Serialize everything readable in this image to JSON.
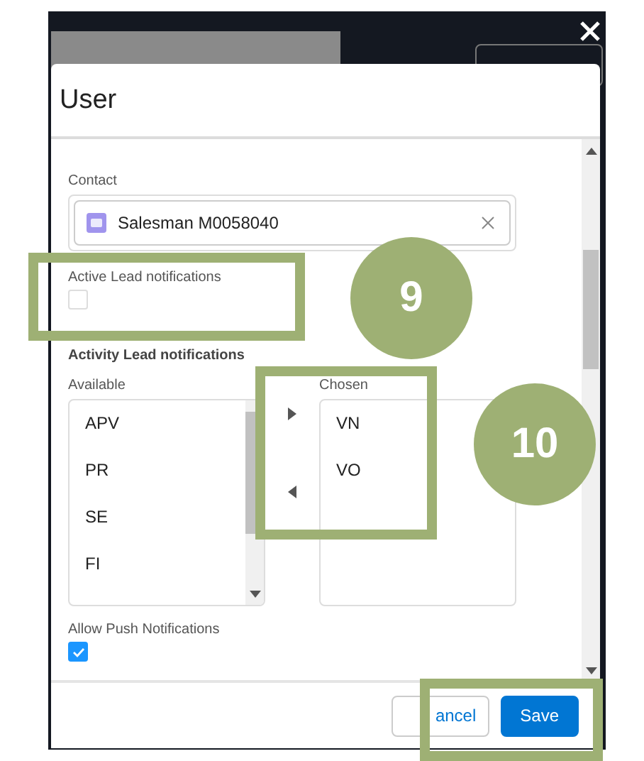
{
  "backdrop": {
    "button": {
      "kind": "outline"
    }
  },
  "dialog": {
    "title": "User",
    "contact": {
      "label": "Contact",
      "value": "Salesman M0058040"
    },
    "active_lead": {
      "label": "Active Lead notifications",
      "checked": false
    },
    "activity_lead": {
      "title": "Activity Lead notifications",
      "available_label": "Available",
      "chosen_label": "Chosen",
      "available": [
        {
          "label": "APV"
        },
        {
          "label": "PR"
        },
        {
          "label": "SE"
        },
        {
          "label": "FI"
        }
      ],
      "chosen": [
        {
          "label": "VN"
        },
        {
          "label": "VO"
        }
      ]
    },
    "push": {
      "label": "Allow Push Notifications",
      "checked": true
    },
    "buttons": [
      {
        "label": "ancel",
        "kind": "neutral"
      },
      {
        "label": "Save",
        "kind": "brand"
      }
    ]
  },
  "callouts": [
    {
      "kind": "frame"
    },
    {
      "kind": "badge",
      "label": "9"
    },
    {
      "kind": "frame"
    },
    {
      "kind": "badge",
      "label": "10"
    },
    {
      "kind": "frame"
    }
  ]
}
